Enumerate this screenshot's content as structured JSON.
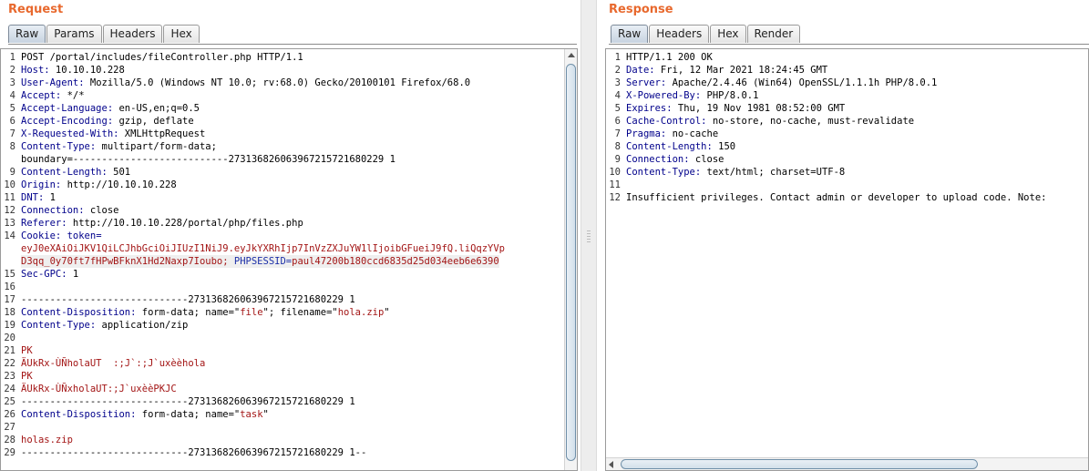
{
  "request": {
    "title": "Request",
    "tabs": [
      "Raw",
      "Params",
      "Headers",
      "Hex"
    ],
    "active_tab": "Raw",
    "line_numbers": [
      "1",
      "2",
      "3",
      "4",
      "5",
      "6",
      "7",
      "8",
      "",
      "9",
      "10",
      "11",
      "12",
      "13",
      "14",
      "",
      "",
      "15",
      "16",
      "17",
      "18",
      "19",
      "20",
      "21",
      "22",
      "23",
      "24",
      "25",
      "26",
      "27",
      "28",
      "29"
    ],
    "lines": [
      {
        "segments": [
          {
            "t": "POST /portal/includes/fileController.php HTTP/1.1"
          }
        ]
      },
      {
        "segments": [
          {
            "t": "Host:",
            "c": "key"
          },
          {
            "t": " 10.10.10.228"
          }
        ]
      },
      {
        "segments": [
          {
            "t": "User-Agent:",
            "c": "key"
          },
          {
            "t": " Mozilla/5.0 (Windows NT 10.0; rv:68.0) Gecko/20100101 Firefox/68.0"
          }
        ]
      },
      {
        "segments": [
          {
            "t": "Accept:",
            "c": "key"
          },
          {
            "t": " */*"
          }
        ]
      },
      {
        "segments": [
          {
            "t": "Accept-Language:",
            "c": "key"
          },
          {
            "t": " en-US,en;q=0.5"
          }
        ]
      },
      {
        "segments": [
          {
            "t": "Accept-Encoding:",
            "c": "key"
          },
          {
            "t": " gzip, deflate"
          }
        ]
      },
      {
        "segments": [
          {
            "t": "X-Requested-With:",
            "c": "key"
          },
          {
            "t": " XMLHttpRequest"
          }
        ]
      },
      {
        "segments": [
          {
            "t": "Content-Type:",
            "c": "key"
          },
          {
            "t": " multipart/form-data;"
          }
        ]
      },
      {
        "segments": [
          {
            "t": "boundary=---------------------------273136826063967215721680229 1"
          }
        ]
      },
      {
        "segments": [
          {
            "t": "Content-Length:",
            "c": "key"
          },
          {
            "t": " 501"
          }
        ]
      },
      {
        "segments": [
          {
            "t": "Origin:",
            "c": "key"
          },
          {
            "t": " http://10.10.10.228"
          }
        ]
      },
      {
        "segments": [
          {
            "t": "DNT:",
            "c": "key"
          },
          {
            "t": " 1"
          }
        ]
      },
      {
        "segments": [
          {
            "t": "Connection:",
            "c": "key"
          },
          {
            "t": " close"
          }
        ]
      },
      {
        "segments": [
          {
            "t": "Referer:",
            "c": "key"
          },
          {
            "t": " http://10.10.10.228/portal/php/files.php"
          }
        ]
      },
      {
        "segments": [
          {
            "t": "Cookie:",
            "c": "key"
          },
          {
            "t": " token=",
            "c": "key"
          }
        ]
      },
      {
        "segments": [
          {
            "t": "eyJ0eXAiOiJKV1QiLCJhbGciOiJIUzI1NiJ9.eyJkYXRhIjp7InVzZXJuYW1lIjoibGFueiJ9fQ.liQqzYVp",
            "c": "red"
          }
        ]
      },
      {
        "segments": [
          {
            "t": "D3qq_0y70ft7fHPwBFknX1Hd2Naxp7Ioubo;",
            "c": "red"
          },
          {
            "t": " PHPSESSID=",
            "c": "blue"
          },
          {
            "t": "paul47200b180ccd6835d25d034eeb6e6390",
            "c": "red"
          }
        ],
        "highlight": true
      },
      {
        "segments": [
          {
            "t": "Sec-GPC:",
            "c": "key"
          },
          {
            "t": " 1"
          }
        ]
      },
      {
        "segments": [
          {
            "t": ""
          }
        ]
      },
      {
        "segments": [
          {
            "t": "-----------------------------273136826063967215721680229 1"
          }
        ]
      },
      {
        "segments": [
          {
            "t": "Content-Disposition:",
            "c": "key"
          },
          {
            "t": " form-data; name=\""
          },
          {
            "t": "file",
            "c": "red"
          },
          {
            "t": "\"; filename=\""
          },
          {
            "t": "hola.zip",
            "c": "red"
          },
          {
            "t": "\""
          }
        ]
      },
      {
        "segments": [
          {
            "t": "Content-Type:",
            "c": "key"
          },
          {
            "t": " application/zip"
          }
        ]
      },
      {
        "segments": [
          {
            "t": ""
          }
        ]
      },
      {
        "segments": [
          {
            "t": "PK",
            "c": "red"
          }
        ]
      },
      {
        "segments": [
          {
            "t": "ÄUkRx-ÙÑholaUT  :;J`:;J`uxèèhola",
            "c": "red"
          }
        ]
      },
      {
        "segments": [
          {
            "t": "PK",
            "c": "red"
          }
        ]
      },
      {
        "segments": [
          {
            "t": "ÄUkRx-ÙÑxholaUT:;J`uxèèPKJC",
            "c": "red"
          }
        ]
      },
      {
        "segments": [
          {
            "t": "-----------------------------273136826063967215721680229 1"
          }
        ]
      },
      {
        "segments": [
          {
            "t": "Content-Disposition:",
            "c": "key"
          },
          {
            "t": " form-data; name=\""
          },
          {
            "t": "task",
            "c": "red"
          },
          {
            "t": "\""
          }
        ]
      },
      {
        "segments": [
          {
            "t": ""
          }
        ]
      },
      {
        "segments": [
          {
            "t": "holas.zip",
            "c": "red"
          }
        ]
      },
      {
        "segments": [
          {
            "t": "-----------------------------273136826063967215721680229 1--"
          }
        ]
      }
    ]
  },
  "response": {
    "title": "Response",
    "tabs": [
      "Raw",
      "Headers",
      "Hex",
      "Render"
    ],
    "active_tab": "Raw",
    "line_numbers": [
      "1",
      "2",
      "3",
      "4",
      "5",
      "6",
      "7",
      "8",
      "9",
      "10",
      "11",
      "12"
    ],
    "lines": [
      {
        "segments": [
          {
            "t": "HTTP/1.1 200 OK"
          }
        ]
      },
      {
        "segments": [
          {
            "t": "Date:",
            "c": "key"
          },
          {
            "t": " Fri, 12 Mar 2021 18:24:45 GMT"
          }
        ]
      },
      {
        "segments": [
          {
            "t": "Server:",
            "c": "key"
          },
          {
            "t": " Apache/2.4.46 (Win64) OpenSSL/1.1.1h PHP/8.0.1"
          }
        ]
      },
      {
        "segments": [
          {
            "t": "X-Powered-By:",
            "c": "key"
          },
          {
            "t": " PHP/8.0.1"
          }
        ]
      },
      {
        "segments": [
          {
            "t": "Expires:",
            "c": "key"
          },
          {
            "t": " Thu, 19 Nov 1981 08:52:00 GMT"
          }
        ]
      },
      {
        "segments": [
          {
            "t": "Cache-Control:",
            "c": "key"
          },
          {
            "t": " no-store, no-cache, must-revalidate"
          }
        ]
      },
      {
        "segments": [
          {
            "t": "Pragma:",
            "c": "key"
          },
          {
            "t": " no-cache"
          }
        ]
      },
      {
        "segments": [
          {
            "t": "Content-Length:",
            "c": "key"
          },
          {
            "t": " 150"
          }
        ]
      },
      {
        "segments": [
          {
            "t": "Connection:",
            "c": "key"
          },
          {
            "t": " close"
          }
        ]
      },
      {
        "segments": [
          {
            "t": "Content-Type:",
            "c": "key"
          },
          {
            "t": " text/html; charset=UTF-8"
          }
        ]
      },
      {
        "segments": [
          {
            "t": ""
          }
        ]
      },
      {
        "segments": [
          {
            "t": "Insufficient privileges. Contact admin or developer to upload code. Note:"
          }
        ]
      }
    ]
  }
}
